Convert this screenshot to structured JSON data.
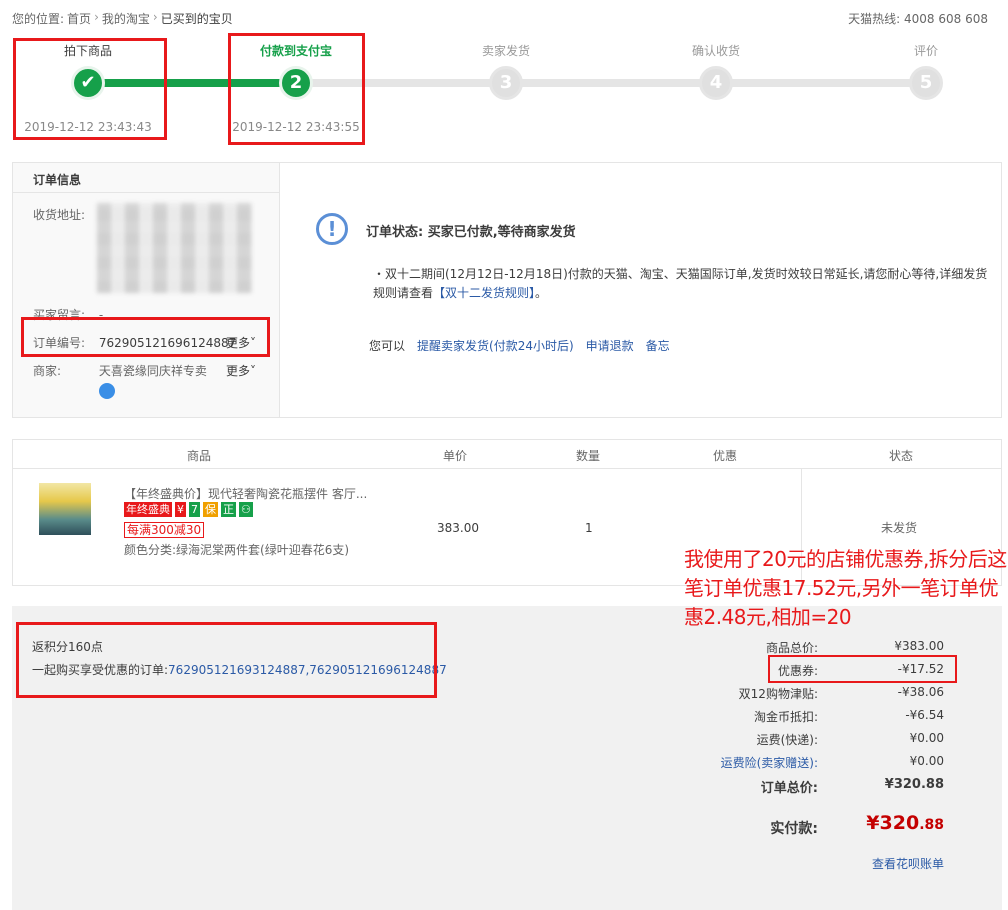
{
  "breadcrumb": {
    "prefix": "您的位置:",
    "items": [
      "首页",
      "我的淘宝",
      "已买到的宝贝"
    ]
  },
  "hotline": "天猫热线: 4008 608 608",
  "steps": [
    {
      "label": "拍下商品",
      "mark": "✔",
      "time": "2019-12-12 23:43:43",
      "state": "done"
    },
    {
      "label": "付款到支付宝",
      "mark": "2",
      "time": "2019-12-12 23:43:55",
      "state": "current"
    },
    {
      "label": "卖家发货",
      "mark": "3",
      "time": "",
      "state": "todo"
    },
    {
      "label": "确认收货",
      "mark": "4",
      "time": "",
      "state": "todo"
    },
    {
      "label": "评价",
      "mark": "5",
      "time": "",
      "state": "todo"
    }
  ],
  "order_info": {
    "title": "订单信息",
    "address_label": "收货地址:",
    "message_label": "买家留言:",
    "message_value": "-",
    "order_no_label": "订单编号:",
    "order_no": "762905121696124887",
    "more": "更多˅",
    "merchant_label": "商家:",
    "merchant": "天喜瓷缘同庆祥专卖"
  },
  "status": {
    "icon_symbol": "!",
    "title": "订单状态: 买家已付款,等待商家发货",
    "notice": "・双十二期间(12月12日-12月18日)付款的天猫、淘宝、天猫国际订单,发货时效较日常延长,请您耐心等待,详细发货规则请查看",
    "notice_link": "【双十二发货规则】",
    "notice_end": "。",
    "actions_prefix": "您可以",
    "actions": [
      "提醒卖家发货(付款24小时后)",
      "申请退款",
      "备忘"
    ]
  },
  "table": {
    "headers": [
      "商品",
      "单价",
      "数量",
      "优惠",
      "状态"
    ],
    "item": {
      "title": "【年终盛典价】现代轻奢陶瓷花瓶摆件 客厅...",
      "badges": [
        {
          "text": "年终盛典",
          "color": "#e8191b"
        },
        {
          "text": "¥",
          "color": "#e8191b"
        },
        {
          "text": "7",
          "color": "#16a04a"
        },
        {
          "text": "保",
          "color": "#f0a000"
        },
        {
          "text": "正",
          "color": "#16a04a"
        },
        {
          "text": "⚇",
          "color": "#16a04a"
        }
      ],
      "promo": "每满300减30",
      "sku": "颜色分类:绿海泥棠两件套(绿叶迎春花6支)",
      "price": "383.00",
      "qty": "1",
      "status": "未发货"
    }
  },
  "summary": {
    "points": "返积分160点",
    "combined_label": "一起购买享受优惠的订单:",
    "combined_orders": "762905121693124887,762905121696124887",
    "fees": [
      {
        "k": "商品总价:",
        "v": "¥383.00"
      },
      {
        "k": "优惠券:",
        "v": "-¥17.52"
      },
      {
        "k": "双12购物津贴:",
        "v": "-¥38.06"
      },
      {
        "k": "淘金币抵扣:",
        "v": "-¥6.54"
      },
      {
        "k": "运费(快递):",
        "v": "¥0.00"
      },
      {
        "k": "运费险(卖家赠送):",
        "v": "¥0.00"
      }
    ],
    "total_label": "订单总价:",
    "total_value": "¥320.88",
    "pay_label": "实付款:",
    "pay_int": "¥320",
    "pay_dec": ".88",
    "huabei": "查看花呗账单"
  },
  "annotation": "我使用了20元的店铺优惠券,拆分后这笔订单优惠17.52元,另外一笔订单优惠2.48元,相加=20",
  "colors": {
    "accent_green": "#16a04a",
    "highlight_red": "#e8191b",
    "link_blue": "#2b5aa6",
    "price_red": "#c40000"
  }
}
